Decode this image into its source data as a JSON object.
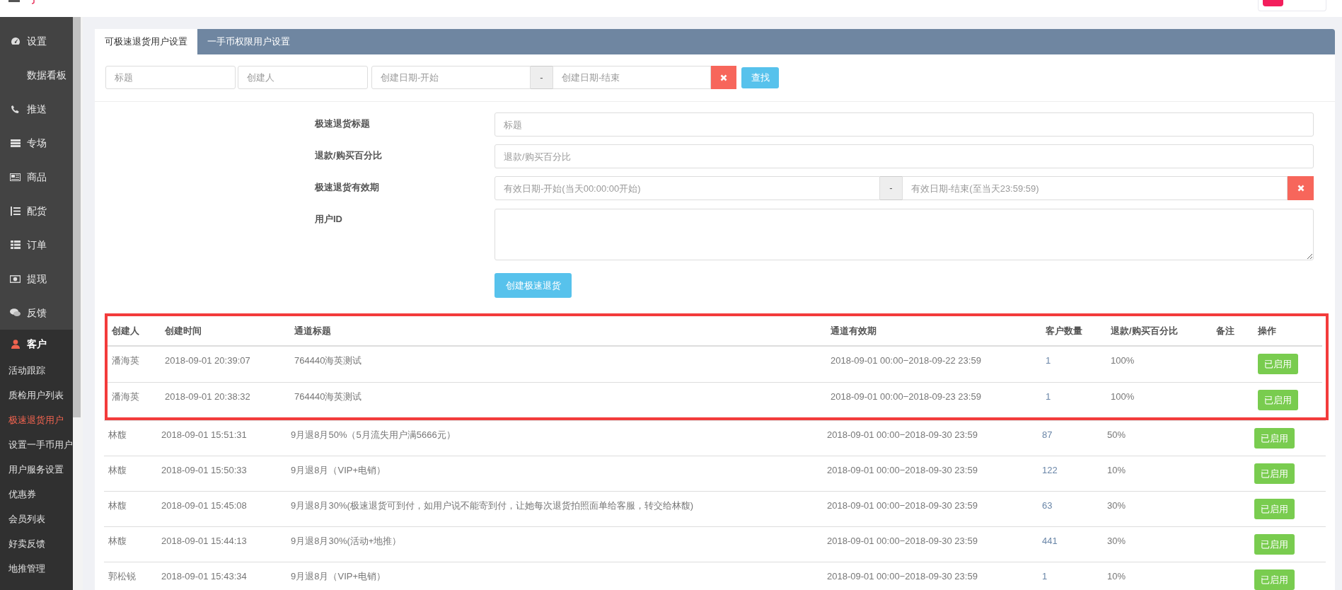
{
  "sidebar": {
    "items": [
      {
        "label": "设置",
        "selected": false
      },
      {
        "label": "数据看板",
        "selected": false
      },
      {
        "label": "推送",
        "selected": false
      },
      {
        "label": "专场",
        "selected": false
      },
      {
        "label": "商品",
        "selected": false
      },
      {
        "label": "配货",
        "selected": false
      },
      {
        "label": "订单",
        "selected": false
      },
      {
        "label": "提现",
        "selected": false
      },
      {
        "label": "反馈",
        "selected": false
      }
    ],
    "section": {
      "label": "客户",
      "children": [
        {
          "label": "活动跟踪",
          "selected": false
        },
        {
          "label": "质检用户列表",
          "selected": false
        },
        {
          "label": "极速退货用户",
          "selected": true
        },
        {
          "label": "设置一手币用户",
          "selected": false
        },
        {
          "label": "用户服务设置",
          "selected": false
        },
        {
          "label": "优惠券",
          "selected": false
        },
        {
          "label": "会员列表",
          "selected": false
        },
        {
          "label": "好卖反馈",
          "selected": false
        },
        {
          "label": "地推管理",
          "selected": false
        }
      ]
    }
  },
  "tabs": [
    {
      "label": "可极速退货用户设置",
      "selected": true
    },
    {
      "label": "一手币权限用户设置",
      "selected": false
    }
  ],
  "filters": {
    "fields": [
      {
        "placeholder": "标题"
      },
      {
        "placeholder": "创建人"
      }
    ],
    "date_range": {
      "start_placeholder": "创建日期-开始",
      "separator": "-",
      "end_placeholder": "创建日期-结束"
    },
    "search_button": "查找"
  },
  "form": {
    "fields": [
      {
        "kind": "text",
        "label": "极速退货标题",
        "placeholder": "标题"
      },
      {
        "kind": "text",
        "label": "退款/购买百分比",
        "placeholder": "退款/购买百分比"
      },
      {
        "kind": "date_range",
        "label": "极速退货有效期",
        "start_placeholder": "有效日期-开始(当天00:00:00开始)",
        "separator": "-",
        "end_placeholder": "有效日期-结束(至当天23:59:59)"
      },
      {
        "kind": "textarea",
        "label": "用户ID"
      }
    ],
    "submit_button": "创建极速退货"
  },
  "table": {
    "columns": [
      "创建人",
      "创建时间",
      "通道标题",
      "通道有效期",
      "客户数量",
      "退款/购买百分比",
      "备注",
      "操作"
    ],
    "rows": [
      {
        "highlighted": true,
        "cells": [
          "潘海英",
          "2018-09-01 20:39:07",
          "764440海英测试",
          "2018-09-01 00:00−2018-09-22 23:59",
          "1",
          "100%"
        ],
        "action": "已启用"
      },
      {
        "highlighted": true,
        "cells": [
          "潘海英",
          "2018-09-01 20:38:32",
          "764440海英测试",
          "2018-09-01 00:00−2018-09-23 23:59",
          "1",
          "100%"
        ],
        "action": "已启用"
      },
      {
        "highlighted": false,
        "cells": [
          "林馥",
          "2018-09-01 15:51:31",
          "9月退8月50%（5月流失用户满5666元）",
          "2018-09-01 00:00−2018-09-30 23:59",
          "87",
          "50%"
        ],
        "action": "已启用"
      },
      {
        "highlighted": false,
        "cells": [
          "林馥",
          "2018-09-01 15:50:33",
          "9月退8月（VIP+电销）",
          "2018-09-01 00:00−2018-09-30 23:59",
          "122",
          "10%"
        ],
        "action": "已启用"
      },
      {
        "highlighted": false,
        "cells": [
          "林馥",
          "2018-09-01 15:45:08",
          "9月退8月30%(极速退货可到付，如用户说不能寄到付，让她每次退货拍照面单给客服，转交给林馥)",
          "2018-09-01 00:00−2018-09-30 23:59",
          "63",
          "30%"
        ],
        "action": "已启用"
      },
      {
        "highlighted": false,
        "cells": [
          "林馥",
          "2018-09-01 15:44:13",
          "9月退8月30%(活动+地推）",
          "2018-09-01 00:00−2018-09-30 23:59",
          "441",
          "30%"
        ],
        "action": "已启用"
      },
      {
        "highlighted": false,
        "cells": [
          "郭松锐",
          "2018-09-01 15:43:34",
          "9月退8月（VIP+电销）",
          "2018-09-01 00:00−2018-09-30 23:59",
          "1",
          "10%"
        ],
        "action": "已启用"
      }
    ]
  }
}
